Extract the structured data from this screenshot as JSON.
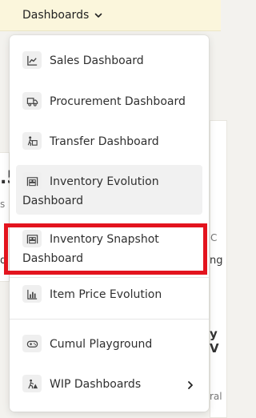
{
  "header": {
    "dashboards_label": "Dashboards"
  },
  "background": {
    "left_fragment_1": ".5",
    "left_fragment_2": "s",
    "left_fragment_3": "d",
    "right_fragment_1": "C",
    "right_fragment_2": "ng",
    "right_fragment_3": "y V",
    "right_fragment_4": "ral"
  },
  "menu": {
    "items": [
      {
        "label": "Sales Dashboard",
        "icon": "line-chart-icon"
      },
      {
        "label": "Procurement Dashboard",
        "icon": "truck-icon"
      },
      {
        "label": "Transfer Dashboard",
        "icon": "transfer-icon"
      },
      {
        "label_line1": "Inventory Evolution",
        "label_line2": "Dashboard",
        "icon": "warehouse-icon"
      },
      {
        "label_line1": "Inventory Snapshot",
        "label_line2": "Dashboard",
        "icon": "warehouse-icon"
      },
      {
        "label": "Item Price Evolution",
        "icon": "bar-chart-icon"
      },
      {
        "label": "Cumul Playground",
        "icon": "gamepad-icon"
      },
      {
        "label": "WIP Dashboards",
        "icon": "construction-icon",
        "has_submenu": true
      }
    ]
  },
  "highlight": {
    "color": "#e3141e",
    "target": "Inventory Snapshot Dashboard"
  }
}
